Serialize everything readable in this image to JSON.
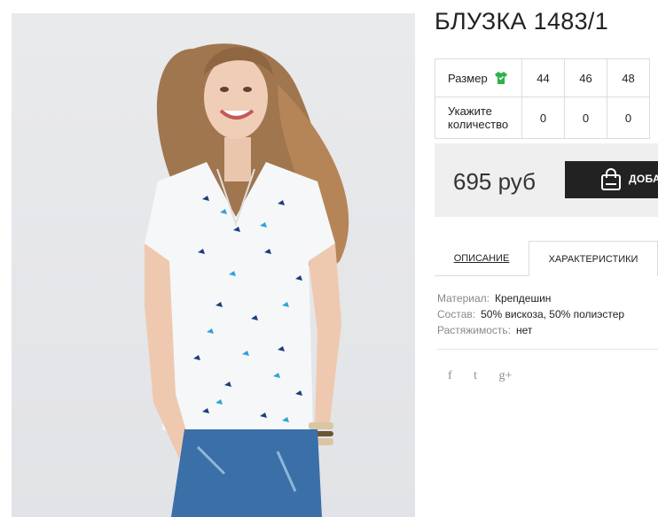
{
  "product": {
    "title": "БЛУЗКА 1483/1",
    "photo_alt": "product-photo"
  },
  "sizes": {
    "size_label": "Размер",
    "qty_label": "Укажите количество",
    "values": [
      "44",
      "46",
      "48"
    ],
    "quantities": [
      "0",
      "0",
      "0"
    ]
  },
  "price": {
    "amount": "695 руб",
    "buy_label": "ДОБАВИТЬ"
  },
  "tabs": {
    "description": "ОПИСАНИЕ",
    "characteristics": "ХАРАКТЕРИСТИКИ"
  },
  "specs": [
    {
      "key": "Материал:",
      "value": "Крепдешин"
    },
    {
      "key": "Состав:",
      "value": "50% вискоза, 50% полиэстер"
    },
    {
      "key": "Растяжимость:",
      "value": "нет"
    }
  ],
  "social": {
    "facebook": "f",
    "twitter": "t",
    "googleplus": "g+"
  },
  "colors": {
    "accent_green": "#2db34a",
    "button_bg": "#222222",
    "price_band": "#efefef"
  }
}
